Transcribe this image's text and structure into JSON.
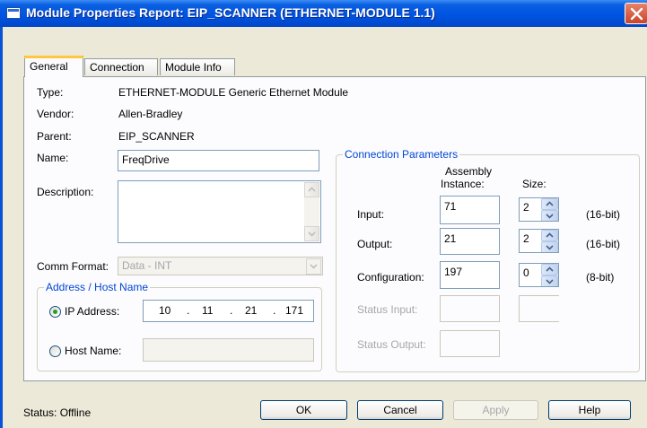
{
  "window": {
    "title": "Module Properties Report: EIP_SCANNER (ETHERNET-MODULE 1.1)",
    "title_bar_color": "#0054e3",
    "close_icon": "close-icon"
  },
  "tabs": [
    {
      "label": "General",
      "active": true
    },
    {
      "label": "Connection",
      "active": false
    },
    {
      "label": "Module Info",
      "active": false
    }
  ],
  "general": {
    "type_label": "Type:",
    "type_value": "ETHERNET-MODULE Generic Ethernet Module",
    "vendor_label": "Vendor:",
    "vendor_value": "Allen-Bradley",
    "parent_label": "Parent:",
    "parent_value": "EIP_SCANNER",
    "name_label": "Name:",
    "name_value": "FreqDrive",
    "description_label": "Description:",
    "description_value": "",
    "comm_format_label": "Comm Format:",
    "comm_format_value": "Data - INT"
  },
  "address": {
    "legend": "Address / Host Name",
    "ip_label": "IP Address:",
    "ip_octets": [
      "10",
      "11",
      "21",
      "171"
    ],
    "ip_selected": true,
    "host_label": "Host Name:",
    "host_value": "",
    "host_selected": false
  },
  "connection": {
    "legend": "Connection Parameters",
    "col_assembly_line1": "Assembly",
    "col_assembly_line2": "Instance:",
    "col_size": "Size:",
    "input_label": "Input:",
    "input_instance": "71",
    "input_size": "2",
    "input_unit": "(16-bit)",
    "output_label": "Output:",
    "output_instance": "21",
    "output_size": "2",
    "output_unit": "(16-bit)",
    "config_label": "Configuration:",
    "config_instance": "197",
    "config_size": "0",
    "config_unit": "(8-bit)",
    "status_input_label": "Status Input:",
    "status_output_label": "Status Output:"
  },
  "footer": {
    "status_text": "Status:  Offline",
    "ok": "OK",
    "cancel": "Cancel",
    "apply": "Apply",
    "help": "Help"
  }
}
